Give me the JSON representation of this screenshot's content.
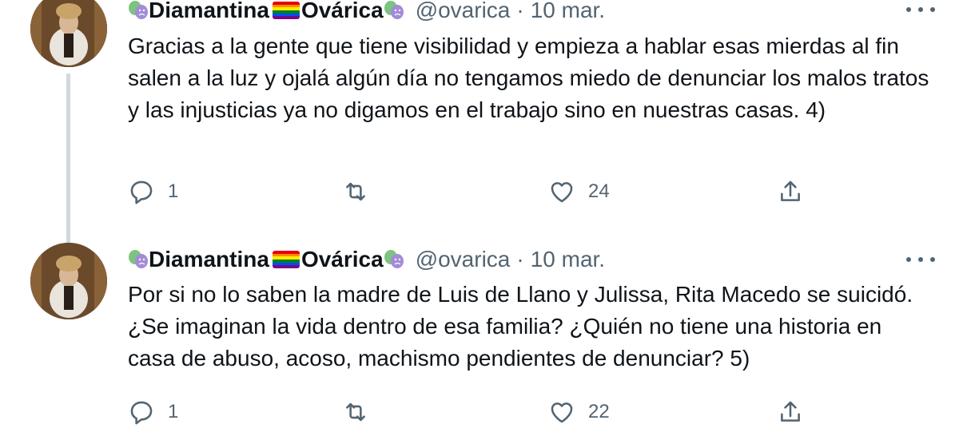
{
  "tweets": [
    {
      "display_name_first": "Diamantina",
      "display_name_second": "Ovárica",
      "handle": "@ovarica",
      "separator": "·",
      "date": "10 mar.",
      "text": "Gracias a la gente que tiene visibilidad y empieza a hablar esas mierdas al fin salen a la luz y ojalá algún día no tengamos miedo de denunciar los malos tratos y las injusticias ya no digamos en el trabajo sino en nuestras casas. 4)",
      "reply_count": "1",
      "retweet_count": "",
      "like_count": "24",
      "icons": [
        "comedy-tragedy-masks-icon",
        "rainbow-flag-icon",
        "reply-icon",
        "retweet-icon",
        "like-icon",
        "share-icon",
        "more-icon"
      ]
    },
    {
      "display_name_first": "Diamantina",
      "display_name_second": "Ovárica",
      "handle": "@ovarica",
      "separator": "·",
      "date": "10 mar.",
      "text": "Por si no lo saben la madre de Luis de Llano y Julissa, Rita Macedo se suicidó. ¿Se imaginan la vida dentro de esa familia? ¿Quién no tiene una historia en casa de abuso, acoso, machismo pendientes de denunciar? 5)",
      "reply_count": "1",
      "retweet_count": "",
      "like_count": "22",
      "icons": [
        "comedy-tragedy-masks-icon",
        "rainbow-flag-icon",
        "reply-icon",
        "retweet-icon",
        "like-icon",
        "share-icon",
        "more-icon"
      ]
    }
  ],
  "colors": {
    "text_primary": "#0f1419",
    "text_secondary": "#536471",
    "thread_line": "#cfd9de",
    "mask_green": "#7cc47f",
    "mask_purple": "#a48bd6"
  }
}
